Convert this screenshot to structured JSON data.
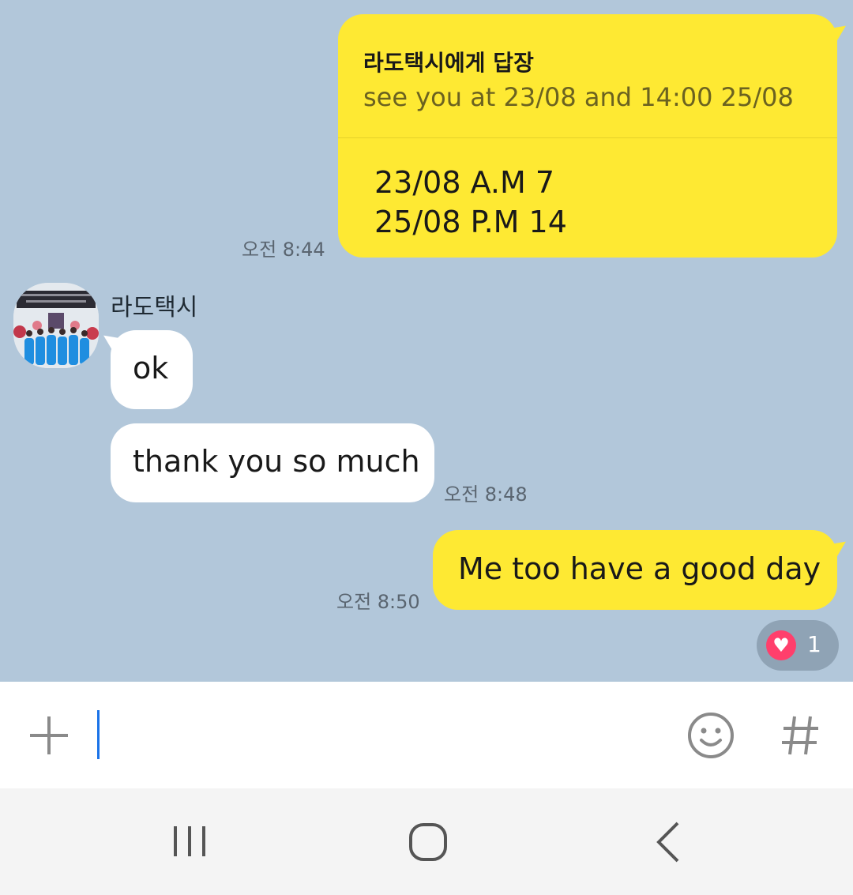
{
  "messages": {
    "reply_bubble": {
      "title": "라도택시에게 답장",
      "quote": "see you at  23/08 and 14:00 25/08",
      "line1": "23/08 A.M 7",
      "line2": "25/08 P.M 14",
      "time": "오전 8:44"
    },
    "sender": {
      "name": "라도택시"
    },
    "ok": {
      "text": "ok"
    },
    "thanks": {
      "text": "thank you so much",
      "time": "오전 8:48"
    },
    "me_too": {
      "text": "Me too have a good  day",
      "time": "오전 8:50"
    },
    "reaction": {
      "icon": "heart-icon",
      "count": "1",
      "color": "#ff3f6c"
    }
  },
  "input": {
    "plus_icon": "plus-icon",
    "emoji_icon": "emoji-icon",
    "hashtag_icon": "hashtag-icon",
    "value": ""
  },
  "navbar": {
    "recents_icon": "recents-icon",
    "home_icon": "home-icon",
    "back_icon": "back-icon"
  },
  "colors": {
    "chat_background": "#b2c7da",
    "my_bubble": "#fee933",
    "other_bubble": "#ffffff"
  }
}
